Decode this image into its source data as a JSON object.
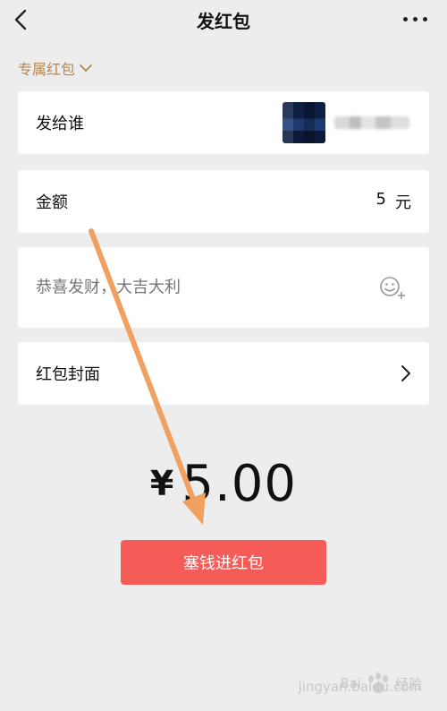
{
  "header": {
    "title": "发红包"
  },
  "packet_type": {
    "label": "专属红包"
  },
  "recipient_row": {
    "label": "发给谁"
  },
  "amount_row": {
    "label": "金额",
    "value": "5",
    "unit": "元"
  },
  "message_row": {
    "placeholder": "恭喜发财，大吉大利"
  },
  "cover_row": {
    "label": "红包封面"
  },
  "total": {
    "currency": "¥",
    "amount": "5.00"
  },
  "submit": {
    "label": "塞钱进红包"
  },
  "watermark": {
    "brand": "Bai",
    "suffix": "经验",
    "sub": "jingyan.baidu.com"
  },
  "annotation": {
    "arrow_color": "#f0a060"
  },
  "colors": {
    "background": "#ededed",
    "card": "#ffffff",
    "accent_red": "#f55c57",
    "gold_text": "#b08755",
    "placeholder": "#b5b5b5"
  }
}
